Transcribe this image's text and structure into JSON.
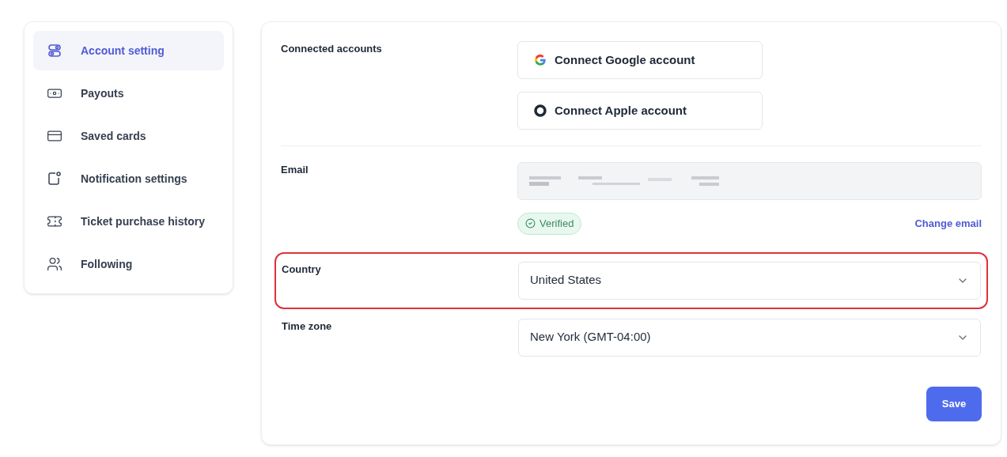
{
  "sidebar": {
    "items": [
      {
        "label": "Account setting",
        "selected": true
      },
      {
        "label": "Payouts",
        "selected": false
      },
      {
        "label": "Saved cards",
        "selected": false
      },
      {
        "label": "Notification settings",
        "selected": false
      },
      {
        "label": "Ticket purchase history",
        "selected": false
      },
      {
        "label": "Following",
        "selected": false
      }
    ]
  },
  "form": {
    "connected_accounts": {
      "label": "Connected accounts",
      "buttons": [
        {
          "label": "Connect Google account",
          "kind": "google"
        },
        {
          "label": "Connect Apple account",
          "kind": "apple"
        }
      ]
    },
    "email": {
      "label": "Email",
      "badge": "Verified",
      "link": "Change email"
    },
    "selects": [
      {
        "label": "Country",
        "value": "United States",
        "highlighted": true
      },
      {
        "label": "Time zone",
        "value": "New York (GMT-04:00)",
        "highlighted": false
      }
    ],
    "save_button": "Save"
  }
}
